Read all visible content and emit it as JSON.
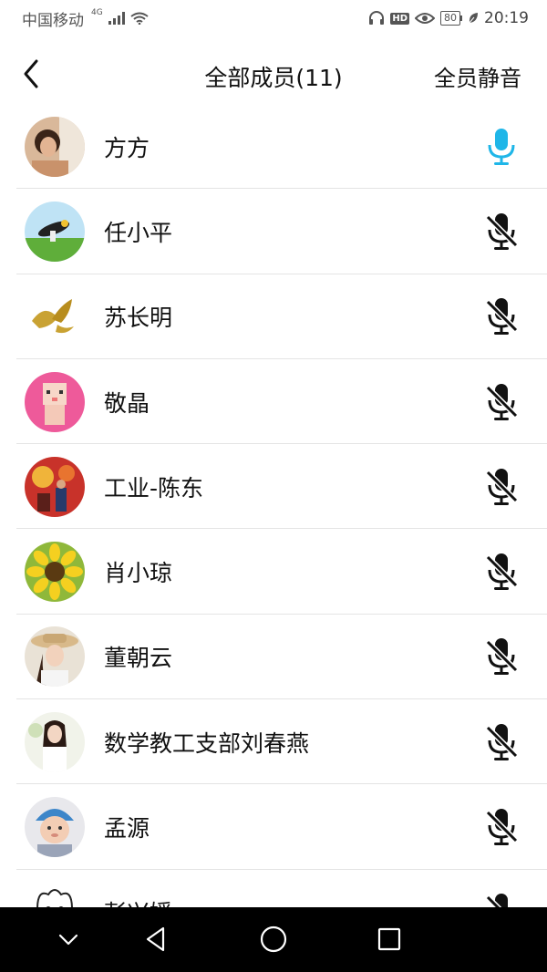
{
  "status_bar": {
    "carrier": "中国移动",
    "network": "4G",
    "battery": "80",
    "time": "20:19",
    "icons": [
      "signal-icon",
      "wifi-icon",
      "headphone-icon",
      "hd-icon",
      "eye-icon",
      "battery-icon",
      "leaf-icon"
    ]
  },
  "header": {
    "title": "全部成员(11)",
    "mute_all": "全员静音",
    "back_icon": "back-chevron-icon"
  },
  "members": [
    {
      "name": "方方",
      "mic": "on",
      "avatar": "photo-girl"
    },
    {
      "name": "任小平",
      "mic": "off",
      "avatar": "photo-bird"
    },
    {
      "name": "苏长明",
      "mic": "off",
      "avatar": "phoenix-logo"
    },
    {
      "name": "敬晶",
      "mic": "off",
      "avatar": "cartoon-pink"
    },
    {
      "name": "工业-陈东",
      "mic": "off",
      "avatar": "photo-festival"
    },
    {
      "name": "肖小琼",
      "mic": "off",
      "avatar": "photo-sunflower"
    },
    {
      "name": "董朝云",
      "mic": "off",
      "avatar": "photo-woman-hat"
    },
    {
      "name": "数学教工支部刘春燕",
      "mic": "off",
      "avatar": "photo-woman"
    },
    {
      "name": "孟源",
      "mic": "off",
      "avatar": "photo-baby"
    },
    {
      "name": "彭兴媛",
      "mic": "off",
      "avatar": "cartoon-white"
    }
  ],
  "colors": {
    "mic_on": "#1fb6e8",
    "mic_off": "#111111",
    "divider": "#e4e4e4",
    "navbar": "#000000"
  },
  "nav": [
    "collapse-icon",
    "back-triangle-icon",
    "home-circle-icon",
    "recents-square-icon"
  ]
}
